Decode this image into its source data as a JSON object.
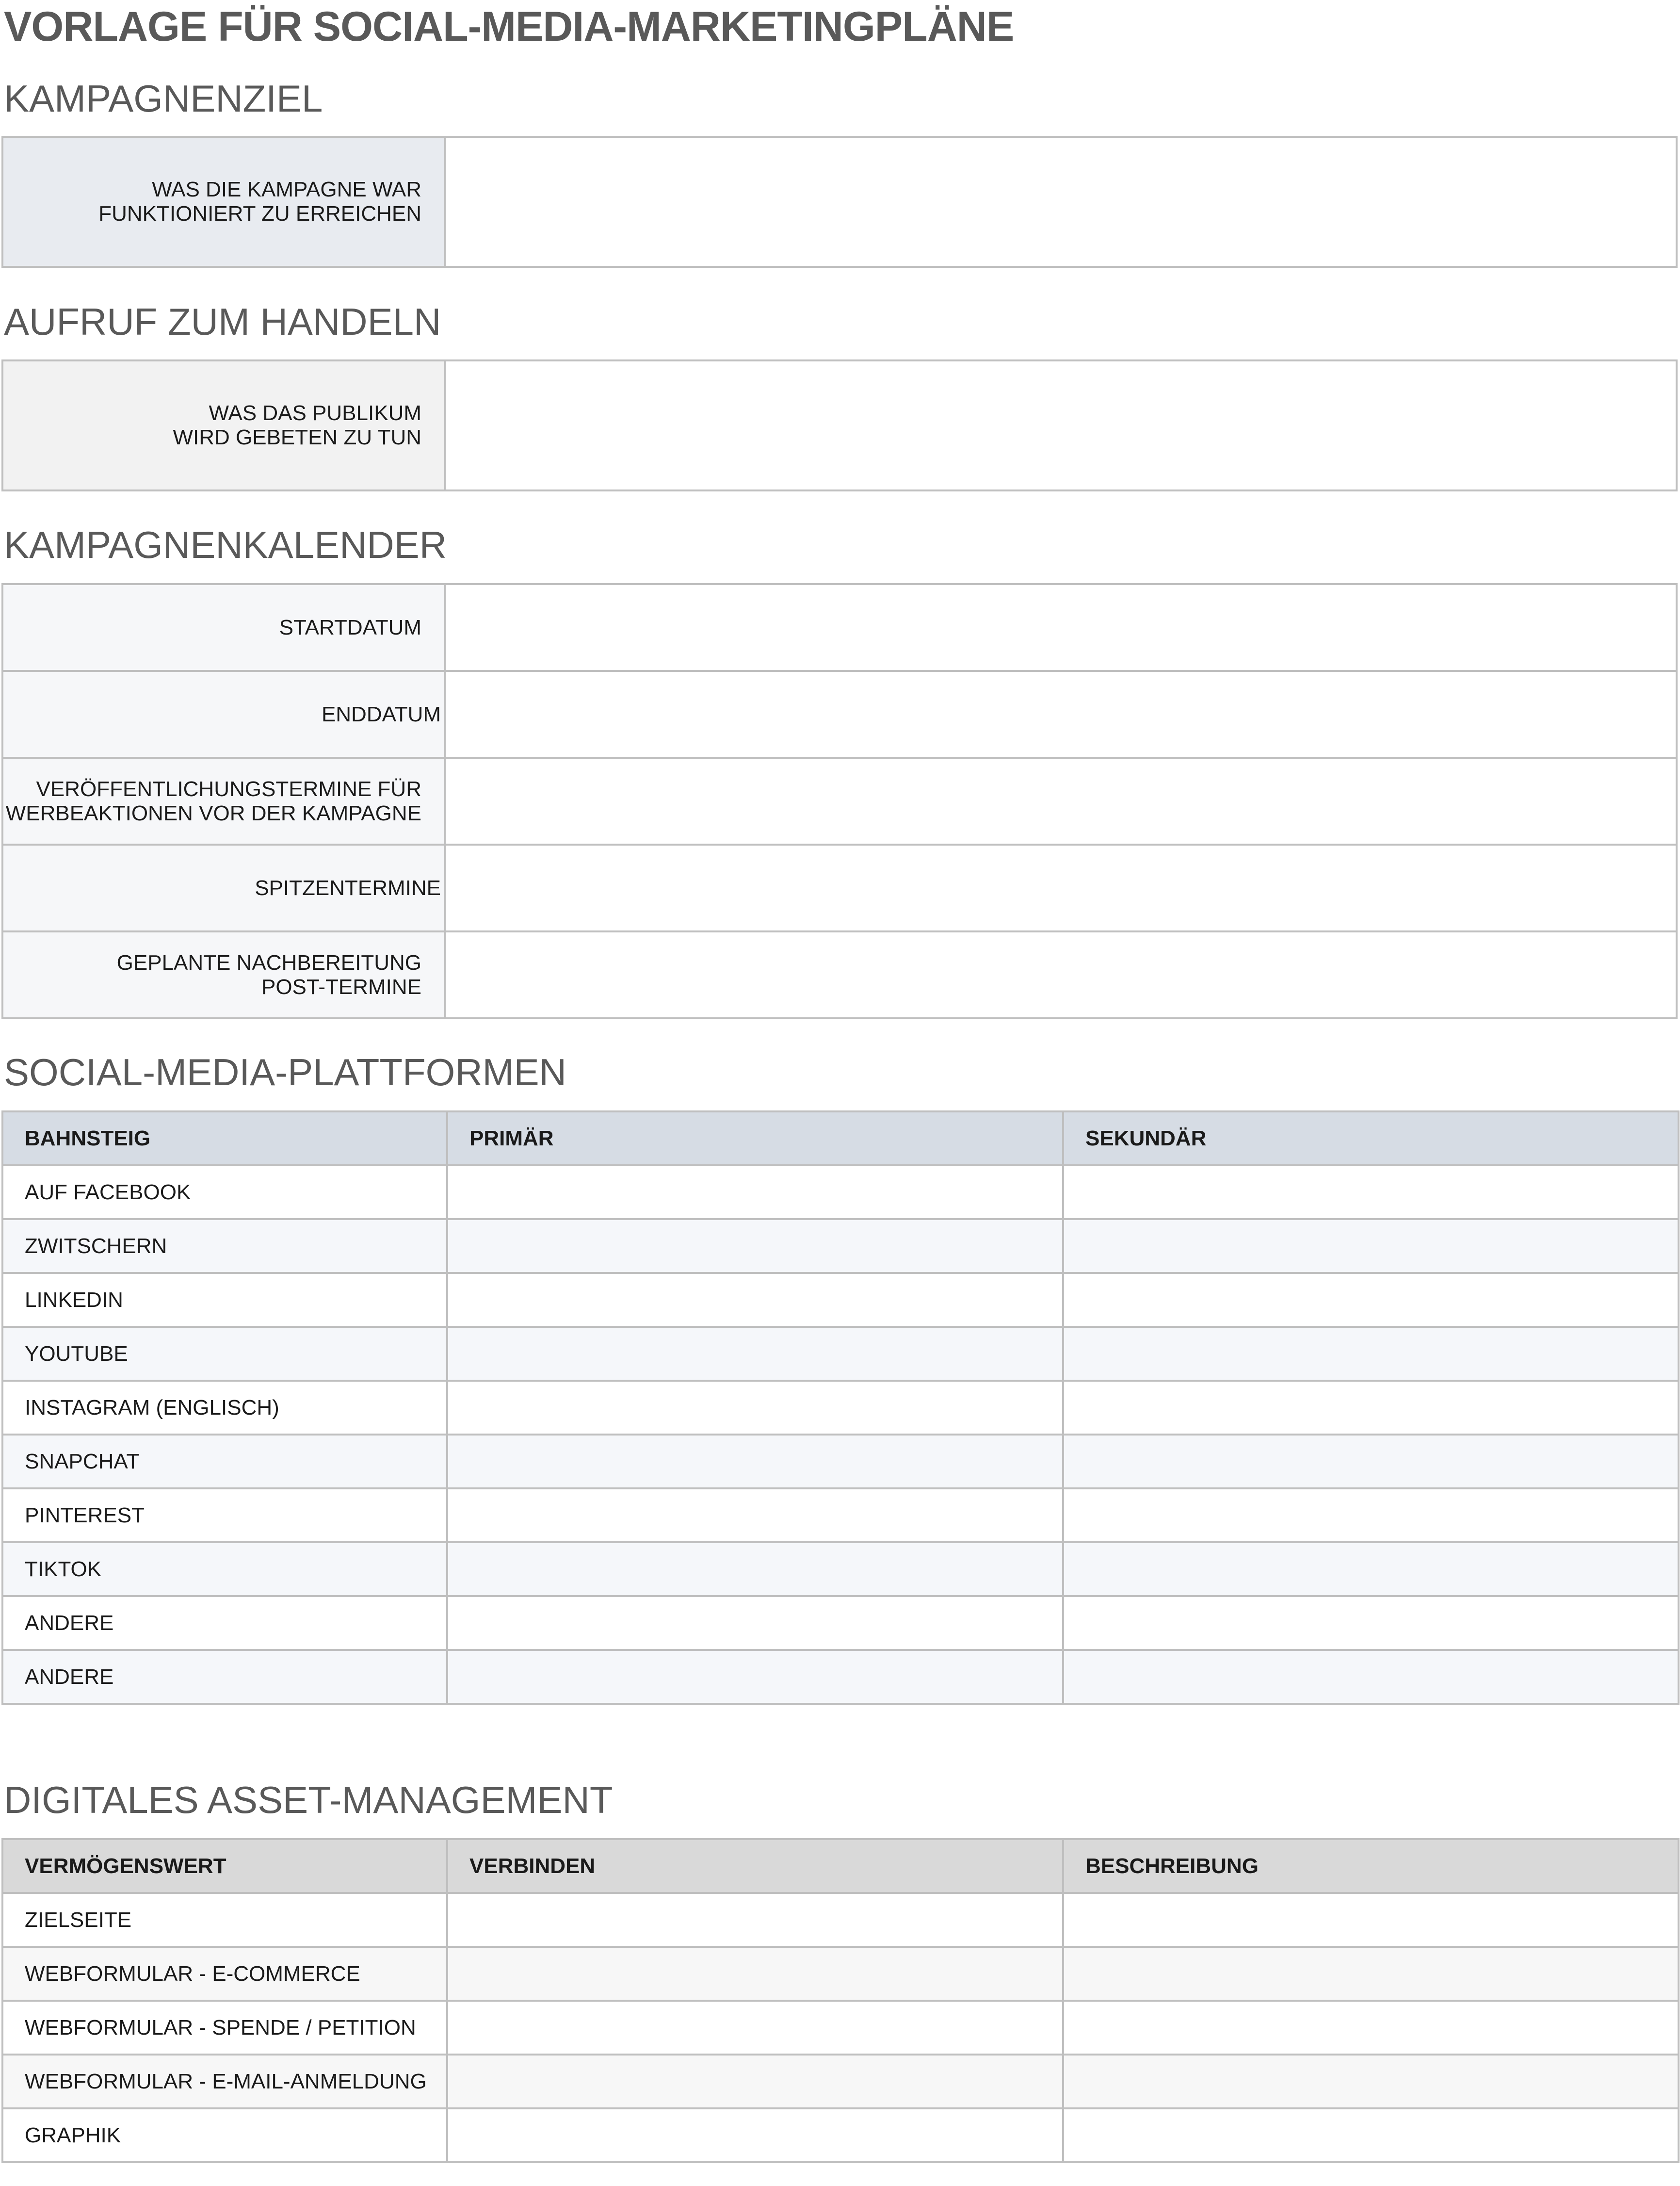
{
  "title": "VORLAGE FÜR SOCIAL-MEDIA-MARKETINGPLÄNE",
  "campaign_goal": {
    "heading": "KAMPAGNENZIEL",
    "label_line1": "WAS DIE KAMPAGNE WAR",
    "label_line2": "FUNKTIONIERT ZU ERREICHEN",
    "value": ""
  },
  "call_to_action": {
    "heading": "AUFRUF ZUM HANDELN",
    "label_line1": "WAS DAS PUBLIKUM",
    "label_line2": "WIRD GEBETEN ZU TUN",
    "value": ""
  },
  "calendar": {
    "heading": "KAMPAGNENKALENDER",
    "rows": [
      {
        "line1": "STARTDATUM",
        "line2": ""
      },
      {
        "line1": "ENDDATUM",
        "line2": ""
      },
      {
        "line1": "VERÖFFENTLICHUNGSTERMINE FÜR",
        "line2": "WERBEAKTIONEN VOR DER KAMPAGNE"
      },
      {
        "line1": "SPITZENTERMINE",
        "line2": ""
      },
      {
        "line1": "GEPLANTE NACHBEREITUNG",
        "line2": "POST-TERMINE"
      }
    ]
  },
  "platforms": {
    "heading": "SOCIAL-MEDIA-PLATTFORMEN",
    "columns": [
      "BAHNSTEIG",
      "PRIMÄR",
      "SEKUNDÄR"
    ],
    "rows": [
      "AUF FACEBOOK",
      "ZWITSCHERN",
      "LINKEDIN",
      "YOUTUBE",
      "INSTAGRAM (ENGLISCH)",
      "SNAPCHAT",
      "PINTEREST",
      "TIKTOK",
      "ANDERE",
      "ANDERE"
    ]
  },
  "assets": {
    "heading": "DIGITALES ASSET-MANAGEMENT",
    "columns": [
      "VERMÖGENSWERT",
      "VERBINDEN",
      "BESCHREIBUNG"
    ],
    "rows": [
      "ZIELSEITE",
      "WEBFORMULAR - E-COMMERCE",
      "WEBFORMULAR - SPENDE / PETITION",
      "WEBFORMULAR - E-MAIL-ANMELDUNG",
      "GRAPHIK"
    ]
  }
}
